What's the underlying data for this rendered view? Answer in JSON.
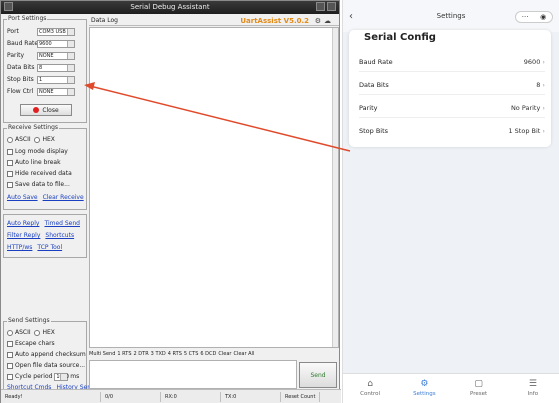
{
  "window": {
    "title": "Serial Debug Assistant",
    "brand": "UartAssist V5.0.2"
  },
  "port_settings": {
    "group_title": "Port Settings",
    "rows": [
      {
        "label": "Port",
        "value": "COM3 USB"
      },
      {
        "label": "Baud Rate",
        "value": "9600"
      },
      {
        "label": "Parity",
        "value": "NONE"
      },
      {
        "label": "Data Bits",
        "value": "8"
      },
      {
        "label": "Stop Bits",
        "value": "1"
      },
      {
        "label": "Flow Ctrl",
        "value": "NONE"
      }
    ],
    "close_label": "Close"
  },
  "rx_settings": {
    "group_title": "Receive Settings",
    "ascii": "ASCII",
    "hex": "HEX",
    "opts": [
      "Log mode display",
      "Auto line break",
      "Hide received data",
      "Save data to file..."
    ],
    "links": [
      "Auto Save",
      "Clear Receive"
    ]
  },
  "extra_links": [
    "Auto Reply",
    "Timed Send",
    "Filter Reply",
    "Shortcuts",
    "HTTP/ws",
    "TCP Tool"
  ],
  "tx_settings": {
    "group_title": "Send Settings",
    "ascii": "ASCII",
    "hex": "HEX",
    "opts": [
      "Escape chars",
      "Auto append checksum",
      "Open file data source...",
      "Cycle period"
    ],
    "period": "1000",
    "unit": "ms",
    "links": [
      "Shortcut Cmds",
      "History Send"
    ]
  },
  "rx_header": {
    "label": "Data Log"
  },
  "settings_bar": {
    "items": [
      "Multi Send",
      "1 RTS",
      "2 DTR",
      "3 TXD",
      "4 RTS",
      "5 CTS",
      "6 DCD",
      "Clear",
      "Clear All"
    ]
  },
  "send_label": "Send",
  "status": {
    "ready": "Ready!",
    "tx": "0/0",
    "rx": "RX:0",
    "txc": "TX:0",
    "reset": "Reset Count"
  },
  "phone": {
    "title": "Settings",
    "card_title": "Serial Config",
    "rows": [
      {
        "label": "Baud Rate",
        "value": "9600"
      },
      {
        "label": "Data Bits",
        "value": "8"
      },
      {
        "label": "Parity",
        "value": "No Parity"
      },
      {
        "label": "Stop Bits",
        "value": "1 Stop Bit"
      }
    ],
    "tabs": [
      {
        "label": "Control",
        "icon": "⌂"
      },
      {
        "label": "Settings",
        "icon": "⚙"
      },
      {
        "label": "Preset",
        "icon": "▢"
      },
      {
        "label": "Info",
        "icon": "☰"
      }
    ]
  },
  "colors": {
    "accent": "#3a7bd5",
    "arrow": "#e0492a",
    "brand": "#e38a16"
  }
}
